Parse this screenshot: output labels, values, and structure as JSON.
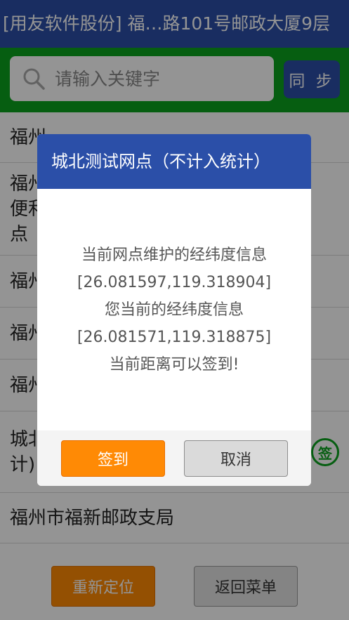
{
  "header": {
    "title": "[用友软件股份] 福…路101号邮政大厦9层"
  },
  "search": {
    "placeholder": "请输入关键字",
    "sync_label": "同 步"
  },
  "list": {
    "items": [
      {
        "label": "福州"
      },
      {
        "line1": "福州",
        "line2": "便利",
        "line3": "点"
      },
      {
        "label": "福州"
      },
      {
        "label": "福州"
      },
      {
        "label": "福州"
      },
      {
        "line1": "城北",
        "line2": "计)",
        "badge": "签"
      },
      {
        "label": "福州市福新邮政支局"
      }
    ]
  },
  "bottom": {
    "relocate_label": "重新定位",
    "back_label": "返回菜单"
  },
  "dialog": {
    "title": "城北测试网点（不计入统计）",
    "lines": [
      "当前网点维护的经纬度信息",
      "[26.081597,119.318904]",
      "您当前的经纬度信息",
      "[26.081571,119.318875]",
      "当前距离可以签到!"
    ],
    "sign_label": "签到",
    "cancel_label": "取消"
  },
  "colors": {
    "header_blue": "#2b4fa8",
    "search_green": "#0ba21e",
    "accent_orange": "#ff8a05"
  }
}
